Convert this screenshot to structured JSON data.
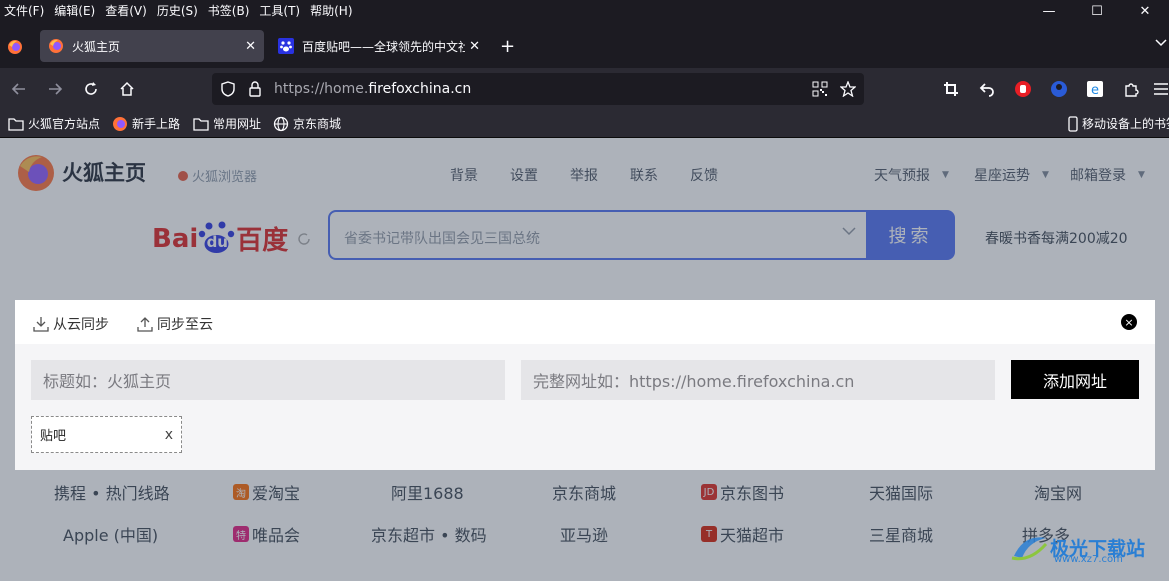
{
  "menu": [
    "文件(F)",
    "编辑(E)",
    "查看(V)",
    "历史(S)",
    "书签(B)",
    "工具(T)",
    "帮助(H)"
  ],
  "window_controls": {
    "minimize": "—",
    "maximize": "☐",
    "close": "✕"
  },
  "tabs": [
    {
      "label": "火狐主页",
      "active": true,
      "icon": "firefox-icon"
    },
    {
      "label": "百度贴吧——全球领先的中文社",
      "active": false,
      "icon": "baidu-paw-icon"
    }
  ],
  "tab_close": "✕",
  "new_tab": "+",
  "url": {
    "prefix": "https://home.",
    "domain": "firefoxchina.cn"
  },
  "bookmarks": [
    {
      "label": "火狐官方站点",
      "icon": "folder-icon"
    },
    {
      "label": "新手上路",
      "icon": "firefox-icon"
    },
    {
      "label": "常用网址",
      "icon": "folder-icon"
    },
    {
      "label": "京东商城",
      "icon": "globe-icon"
    }
  ],
  "mobile_bookmarks": "移动设备上的书签",
  "page": {
    "logo_text": "火狐主页",
    "browser_link": "火狐浏览器",
    "nav": [
      "背景",
      "设置",
      "举报",
      "联系",
      "反馈"
    ],
    "right_nav": [
      "天气预报",
      "星座运势",
      "邮箱登录"
    ],
    "baidu_logo": {
      "bai": "Bai",
      "du": "du",
      "cn": "百度"
    },
    "search_placeholder": "省委书记带队出国会见三国总统",
    "search_button": "搜索",
    "promo": "春暖书香每满200减20",
    "sites_row1": [
      {
        "label": "携程 • 热门线路",
        "icon": ""
      },
      {
        "label": "爱淘宝",
        "icon": "淘"
      },
      {
        "label": "阿里1688",
        "icon": ""
      },
      {
        "label": "京东商城",
        "icon": ""
      },
      {
        "label": "京东图书",
        "icon": "JD"
      },
      {
        "label": "天猫国际",
        "icon": ""
      },
      {
        "label": "淘宝网",
        "icon": ""
      }
    ],
    "sites_row2": [
      {
        "label": "Apple (中国)",
        "icon": ""
      },
      {
        "label": "唯品会",
        "icon": "特"
      },
      {
        "label": "京东超市 • 数码",
        "icon": ""
      },
      {
        "label": "亚马逊",
        "icon": ""
      },
      {
        "label": "天猫超市",
        "icon": "T"
      },
      {
        "label": "三星商城",
        "icon": ""
      },
      {
        "label": "拼多多",
        "icon": ""
      }
    ]
  },
  "dialog": {
    "from_cloud": "从云同步",
    "to_cloud": "同步至云",
    "close": "×",
    "title_placeholder": "标题如：火狐主页",
    "url_placeholder": "完整网址如：https://home.firefoxchina.cn",
    "add_button": "添加网址",
    "chip_label": "贴吧",
    "chip_remove": "x"
  },
  "watermark": {
    "text": "极光下载站",
    "url": "www.xz7.com"
  },
  "colors": {
    "accent": "#4e6ef2",
    "chrome_dark": "#1c1b22",
    "toolbar": "#2b2a33",
    "baidu_red": "#de2121",
    "baidu_blue": "#2932e1"
  }
}
